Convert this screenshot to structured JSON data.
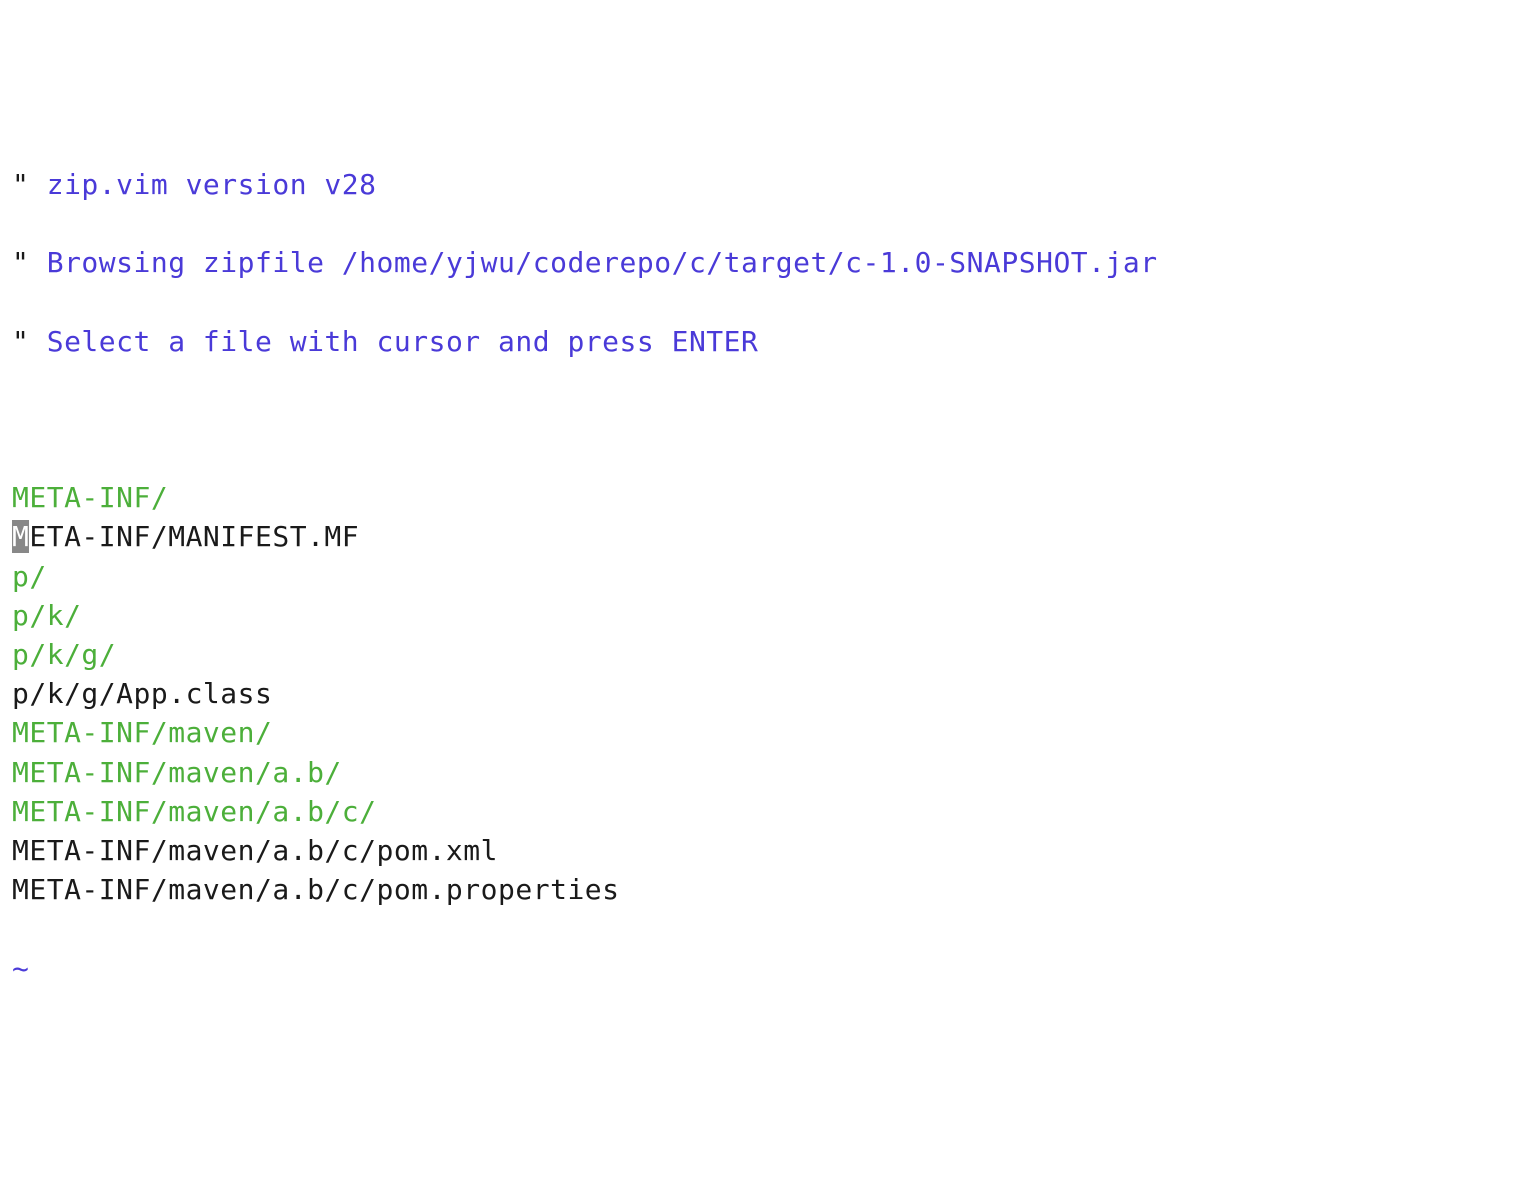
{
  "comments": {
    "quote": "\"",
    "line1": " zip.vim version v28",
    "line2": " Browsing zipfile /home/yjwu/coderepo/c/target/c-1.0-SNAPSHOT.jar",
    "line3": " Select a file with cursor and press ENTER"
  },
  "entries": [
    {
      "text": "META-INF/",
      "type": "dir",
      "cursor": false
    },
    {
      "text": "META-INF/MANIFEST.MF",
      "type": "file",
      "cursor": true
    },
    {
      "text": "p/",
      "type": "dir",
      "cursor": false
    },
    {
      "text": "p/k/",
      "type": "dir",
      "cursor": false
    },
    {
      "text": "p/k/g/",
      "type": "dir",
      "cursor": false
    },
    {
      "text": "p/k/g/App.class",
      "type": "file",
      "cursor": false
    },
    {
      "text": "META-INF/maven/",
      "type": "dir",
      "cursor": false
    },
    {
      "text": "META-INF/maven/a.b/",
      "type": "dir",
      "cursor": false
    },
    {
      "text": "META-INF/maven/a.b/c/",
      "type": "dir",
      "cursor": false
    },
    {
      "text": "META-INF/maven/a.b/c/pom.xml",
      "type": "file",
      "cursor": false
    },
    {
      "text": "META-INF/maven/a.b/c/pom.properties",
      "type": "file",
      "cursor": false
    }
  ],
  "tilde": "~"
}
